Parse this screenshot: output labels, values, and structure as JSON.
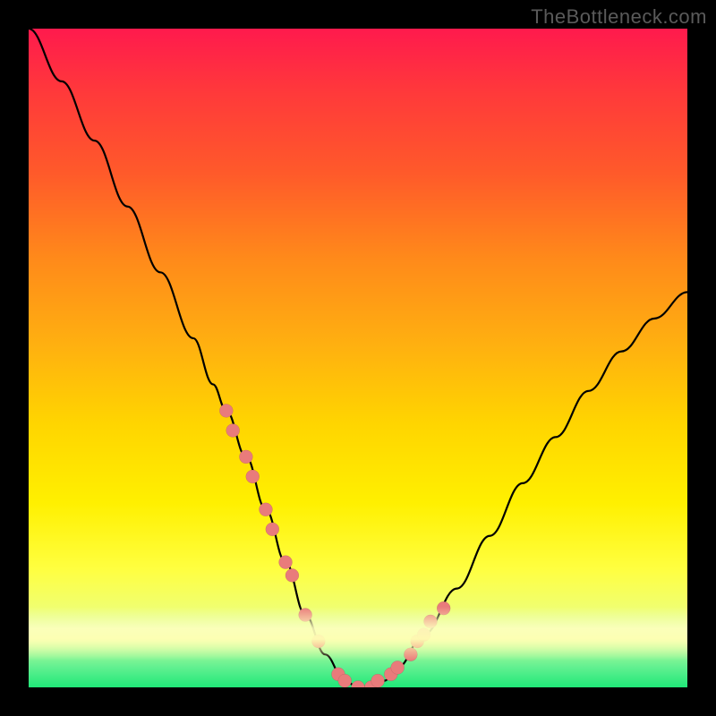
{
  "watermark": "TheBottleneck.com",
  "chart_data": {
    "type": "line",
    "title": "",
    "xlabel": "",
    "ylabel": "",
    "xlim": [
      0,
      100
    ],
    "ylim": [
      0,
      100
    ],
    "grid": false,
    "series": [
      {
        "name": "bottleneck-curve",
        "x": [
          0,
          5,
          10,
          15,
          20,
          25,
          28,
          30,
          33,
          36,
          39,
          42,
          45,
          48,
          50,
          52,
          54,
          56,
          60,
          65,
          70,
          75,
          80,
          85,
          90,
          95,
          100
        ],
        "y": [
          100,
          92,
          83,
          73,
          63,
          53,
          46,
          42,
          35,
          27,
          19,
          11,
          5,
          1,
          0,
          0,
          1,
          3,
          8,
          15,
          23,
          31,
          38,
          45,
          51,
          56,
          60
        ]
      }
    ],
    "points": {
      "name": "highlighted-points",
      "x": [
        30,
        31,
        33,
        34,
        36,
        37,
        39,
        40,
        42,
        44,
        47,
        48,
        50,
        52,
        53,
        55,
        56,
        58,
        59,
        60,
        61,
        63
      ],
      "y": [
        42,
        39,
        35,
        32,
        27,
        24,
        19,
        17,
        11,
        7,
        2,
        1,
        0,
        0,
        1,
        2,
        3,
        5,
        7,
        8,
        10,
        12
      ]
    },
    "background_gradient": {
      "top": "#ff1a4d",
      "mid": "#ffd500",
      "bottom": "#20e878"
    }
  }
}
